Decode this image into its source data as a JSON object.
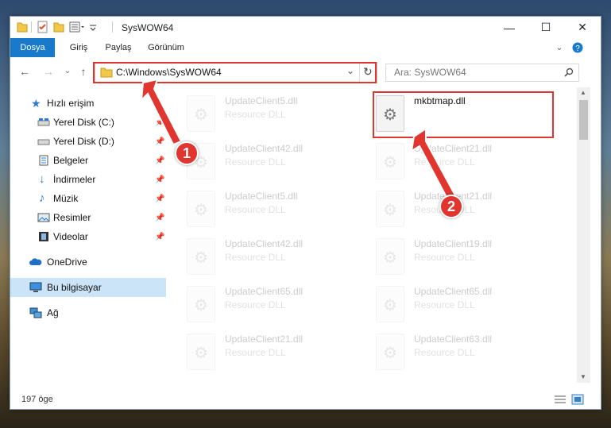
{
  "window": {
    "title": "SysWOW64"
  },
  "window_controls": {
    "minimize": "—",
    "maximize": "☐",
    "close": "✕"
  },
  "ribbon": {
    "tabs": [
      "Dosya",
      "Giriş",
      "Paylaş",
      "Görünüm"
    ]
  },
  "nav": {
    "address": "C:\\Windows\\SysWOW64",
    "search_placeholder": "Ara: SysWOW64"
  },
  "sidebar": {
    "items": [
      {
        "label": "Hızlı erişim",
        "icon": "star-icon",
        "pinned": false
      },
      {
        "label": "Yerel Disk (C:)",
        "icon": "drive-icon",
        "pinned": true
      },
      {
        "label": "Yerel Disk (D:)",
        "icon": "drive-icon",
        "pinned": true
      },
      {
        "label": "Belgeler",
        "icon": "documents-icon",
        "pinned": true
      },
      {
        "label": "İndirmeler",
        "icon": "download-icon",
        "pinned": true
      },
      {
        "label": "Müzik",
        "icon": "music-icon",
        "pinned": true
      },
      {
        "label": "Resimler",
        "icon": "pictures-icon",
        "pinned": true
      },
      {
        "label": "Videolar",
        "icon": "video-icon",
        "pinned": true
      },
      {
        "label": "OneDrive",
        "icon": "cloud-icon",
        "pinned": false
      },
      {
        "label": "Bu bilgisayar",
        "icon": "computer-icon",
        "pinned": false,
        "selected": true
      },
      {
        "label": "Ağ",
        "icon": "network-icon",
        "pinned": false
      }
    ]
  },
  "files": {
    "highlighted": {
      "name": "mkbtmap.dll",
      "type": ""
    },
    "left_column": [
      {
        "name": "UpdateClient5.dll",
        "type": "Resource DLL"
      },
      {
        "name": "UpdateClient42.dll",
        "type": "Resource DLL"
      },
      {
        "name": "UpdateClient5.dll",
        "type": "Resource DLL"
      },
      {
        "name": "UpdateClient42.dll",
        "type": "Resource DLL"
      },
      {
        "name": "UpdateClient65.dll",
        "type": "Resource DLL"
      },
      {
        "name": "UpdateClient21.dll",
        "type": "Resource DLL"
      }
    ],
    "right_column": [
      {
        "name": "UpdateClient21.dll",
        "type": "Resource DLL"
      },
      {
        "name": "UpdateClient21.dll",
        "type": "Resource DLL"
      },
      {
        "name": "UpdateClient19.dll",
        "type": "Resource DLL"
      },
      {
        "name": "UpdateClient65.dll",
        "type": "Resource DLL"
      },
      {
        "name": "UpdateClient63.dll",
        "type": "Resource DLL"
      }
    ]
  },
  "status": {
    "count_text": "197 öge"
  },
  "annotations": {
    "badge1": "1",
    "badge2": "2",
    "color": "#e0362f"
  }
}
